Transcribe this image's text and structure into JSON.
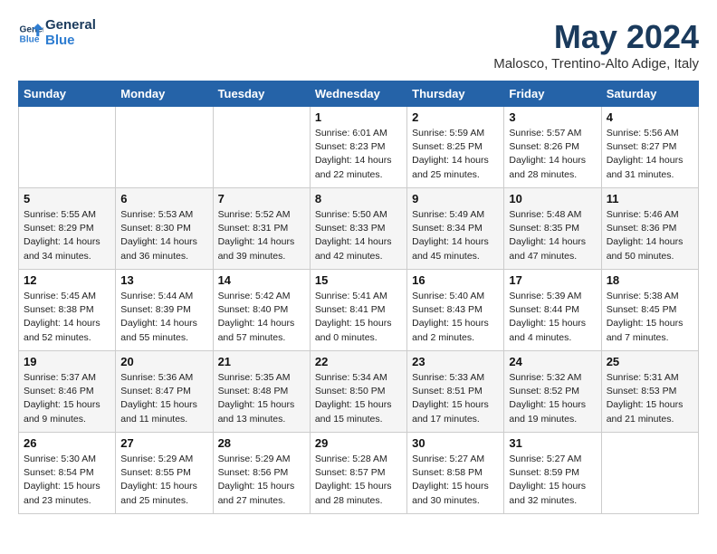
{
  "logo": {
    "line1": "General",
    "line2": "Blue"
  },
  "title": "May 2024",
  "location": "Malosco, Trentino-Alto Adige, Italy",
  "weekdays": [
    "Sunday",
    "Monday",
    "Tuesday",
    "Wednesday",
    "Thursday",
    "Friday",
    "Saturday"
  ],
  "weeks": [
    [
      {
        "day": "",
        "info": ""
      },
      {
        "day": "",
        "info": ""
      },
      {
        "day": "",
        "info": ""
      },
      {
        "day": "1",
        "info": "Sunrise: 6:01 AM\nSunset: 8:23 PM\nDaylight: 14 hours\nand 22 minutes."
      },
      {
        "day": "2",
        "info": "Sunrise: 5:59 AM\nSunset: 8:25 PM\nDaylight: 14 hours\nand 25 minutes."
      },
      {
        "day": "3",
        "info": "Sunrise: 5:57 AM\nSunset: 8:26 PM\nDaylight: 14 hours\nand 28 minutes."
      },
      {
        "day": "4",
        "info": "Sunrise: 5:56 AM\nSunset: 8:27 PM\nDaylight: 14 hours\nand 31 minutes."
      }
    ],
    [
      {
        "day": "5",
        "info": "Sunrise: 5:55 AM\nSunset: 8:29 PM\nDaylight: 14 hours\nand 34 minutes."
      },
      {
        "day": "6",
        "info": "Sunrise: 5:53 AM\nSunset: 8:30 PM\nDaylight: 14 hours\nand 36 minutes."
      },
      {
        "day": "7",
        "info": "Sunrise: 5:52 AM\nSunset: 8:31 PM\nDaylight: 14 hours\nand 39 minutes."
      },
      {
        "day": "8",
        "info": "Sunrise: 5:50 AM\nSunset: 8:33 PM\nDaylight: 14 hours\nand 42 minutes."
      },
      {
        "day": "9",
        "info": "Sunrise: 5:49 AM\nSunset: 8:34 PM\nDaylight: 14 hours\nand 45 minutes."
      },
      {
        "day": "10",
        "info": "Sunrise: 5:48 AM\nSunset: 8:35 PM\nDaylight: 14 hours\nand 47 minutes."
      },
      {
        "day": "11",
        "info": "Sunrise: 5:46 AM\nSunset: 8:36 PM\nDaylight: 14 hours\nand 50 minutes."
      }
    ],
    [
      {
        "day": "12",
        "info": "Sunrise: 5:45 AM\nSunset: 8:38 PM\nDaylight: 14 hours\nand 52 minutes."
      },
      {
        "day": "13",
        "info": "Sunrise: 5:44 AM\nSunset: 8:39 PM\nDaylight: 14 hours\nand 55 minutes."
      },
      {
        "day": "14",
        "info": "Sunrise: 5:42 AM\nSunset: 8:40 PM\nDaylight: 14 hours\nand 57 minutes."
      },
      {
        "day": "15",
        "info": "Sunrise: 5:41 AM\nSunset: 8:41 PM\nDaylight: 15 hours\nand 0 minutes."
      },
      {
        "day": "16",
        "info": "Sunrise: 5:40 AM\nSunset: 8:43 PM\nDaylight: 15 hours\nand 2 minutes."
      },
      {
        "day": "17",
        "info": "Sunrise: 5:39 AM\nSunset: 8:44 PM\nDaylight: 15 hours\nand 4 minutes."
      },
      {
        "day": "18",
        "info": "Sunrise: 5:38 AM\nSunset: 8:45 PM\nDaylight: 15 hours\nand 7 minutes."
      }
    ],
    [
      {
        "day": "19",
        "info": "Sunrise: 5:37 AM\nSunset: 8:46 PM\nDaylight: 15 hours\nand 9 minutes."
      },
      {
        "day": "20",
        "info": "Sunrise: 5:36 AM\nSunset: 8:47 PM\nDaylight: 15 hours\nand 11 minutes."
      },
      {
        "day": "21",
        "info": "Sunrise: 5:35 AM\nSunset: 8:48 PM\nDaylight: 15 hours\nand 13 minutes."
      },
      {
        "day": "22",
        "info": "Sunrise: 5:34 AM\nSunset: 8:50 PM\nDaylight: 15 hours\nand 15 minutes."
      },
      {
        "day": "23",
        "info": "Sunrise: 5:33 AM\nSunset: 8:51 PM\nDaylight: 15 hours\nand 17 minutes."
      },
      {
        "day": "24",
        "info": "Sunrise: 5:32 AM\nSunset: 8:52 PM\nDaylight: 15 hours\nand 19 minutes."
      },
      {
        "day": "25",
        "info": "Sunrise: 5:31 AM\nSunset: 8:53 PM\nDaylight: 15 hours\nand 21 minutes."
      }
    ],
    [
      {
        "day": "26",
        "info": "Sunrise: 5:30 AM\nSunset: 8:54 PM\nDaylight: 15 hours\nand 23 minutes."
      },
      {
        "day": "27",
        "info": "Sunrise: 5:29 AM\nSunset: 8:55 PM\nDaylight: 15 hours\nand 25 minutes."
      },
      {
        "day": "28",
        "info": "Sunrise: 5:29 AM\nSunset: 8:56 PM\nDaylight: 15 hours\nand 27 minutes."
      },
      {
        "day": "29",
        "info": "Sunrise: 5:28 AM\nSunset: 8:57 PM\nDaylight: 15 hours\nand 28 minutes."
      },
      {
        "day": "30",
        "info": "Sunrise: 5:27 AM\nSunset: 8:58 PM\nDaylight: 15 hours\nand 30 minutes."
      },
      {
        "day": "31",
        "info": "Sunrise: 5:27 AM\nSunset: 8:59 PM\nDaylight: 15 hours\nand 32 minutes."
      },
      {
        "day": "",
        "info": ""
      }
    ]
  ]
}
